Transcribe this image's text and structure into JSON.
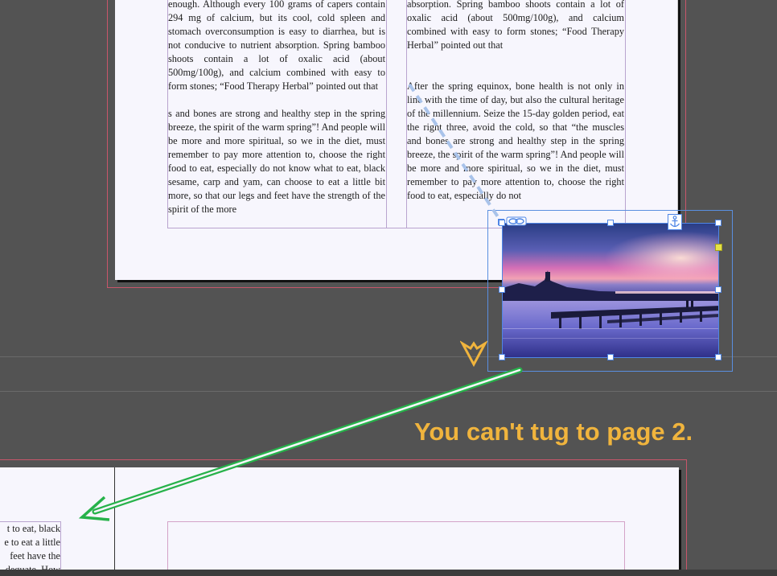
{
  "page1": {
    "left_column_text": "enough. Although every 100 grams of capers contain 294 mg of calcium, but its cool, cold spleen and stomach overconsumption is easy to diarrhea, but is not conducive to nutrient absorption. Spring bamboo shoots contain a lot of oxalic acid (about 500mg/100g), and calcium combined with easy to form stones; “Food Therapy Herbal” pointed out that\n\ns and bones are strong and healthy step in the spring breeze, the spirit of the warm spring”! And people will be more and more spiritual, so we in the diet, must remember to pay more attention to, choose the right food to eat, especially do not know what to eat, black sesame, carp and yam, can choose to eat a little bit more, so that our legs and feet have the strength of the spirit of the more",
    "right_column_text": "absorption. Spring bamboo shoots contain a lot of oxalic acid (about 500mg/100g), and calcium combined with easy to form stones; “Food Therapy Herbal” pointed out that\n\n\nAfter the spring equinox, bone health is not only in line with the time of day, but also the cultural heritage of the millennium. Seize the 15-day golden period, eat the right three, avoid the cold, so that “the muscles and bones are strong and healthy step in the spring breeze, the spirit of the warm spring”! And people will be more and more spiritual, so we in the diet, must remember to pay more attention to, choose the right food to eat, especially do not"
  },
  "page2": {
    "left_column_text": "t to eat, black\ne to eat a little\nfeet have the\ndequate. How"
  },
  "caption": {
    "text": "You can't tug to page 2."
  },
  "colors": {
    "pasteboard": "#535353",
    "page": "#f7f6fd",
    "bleed": "#c8566a",
    "frame": "#4f86e6",
    "caption": "#f0b43d",
    "arrow": "#27b24a"
  },
  "icons": {
    "link": "link-chain-icon",
    "anchor": "anchor-icon",
    "drag": "drag-cursor-chevron-icon"
  }
}
